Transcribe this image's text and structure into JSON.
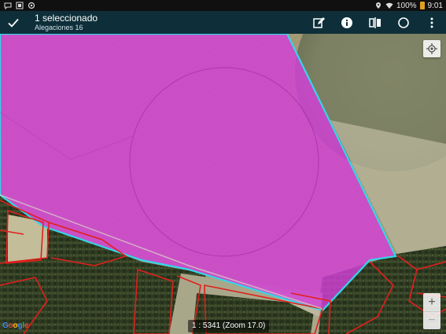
{
  "status_bar": {
    "battery": "100%",
    "time": "9:01",
    "icons": [
      "notification-icon",
      "screenshot-icon",
      "sync-icon",
      "location-icon",
      "wifi-icon",
      "battery-icon"
    ]
  },
  "action_bar": {
    "title": "1 seleccionado",
    "subtitle": "Alegaciones 16",
    "actions": [
      "edit-icon",
      "info-icon",
      "split-icon",
      "circle-icon",
      "more-icon"
    ]
  },
  "map": {
    "attribution": "Google",
    "scale_text": "1 : 5341 (Zoom 17.0)",
    "zoom_in_label": "+",
    "zoom_out_label": "−",
    "colors": {
      "selection_fill": "#d33fd8",
      "selection_outline": "#33d6e8",
      "parcel_outline": "#e0201c",
      "toolbar_bg": "#0e2f3a"
    }
  }
}
